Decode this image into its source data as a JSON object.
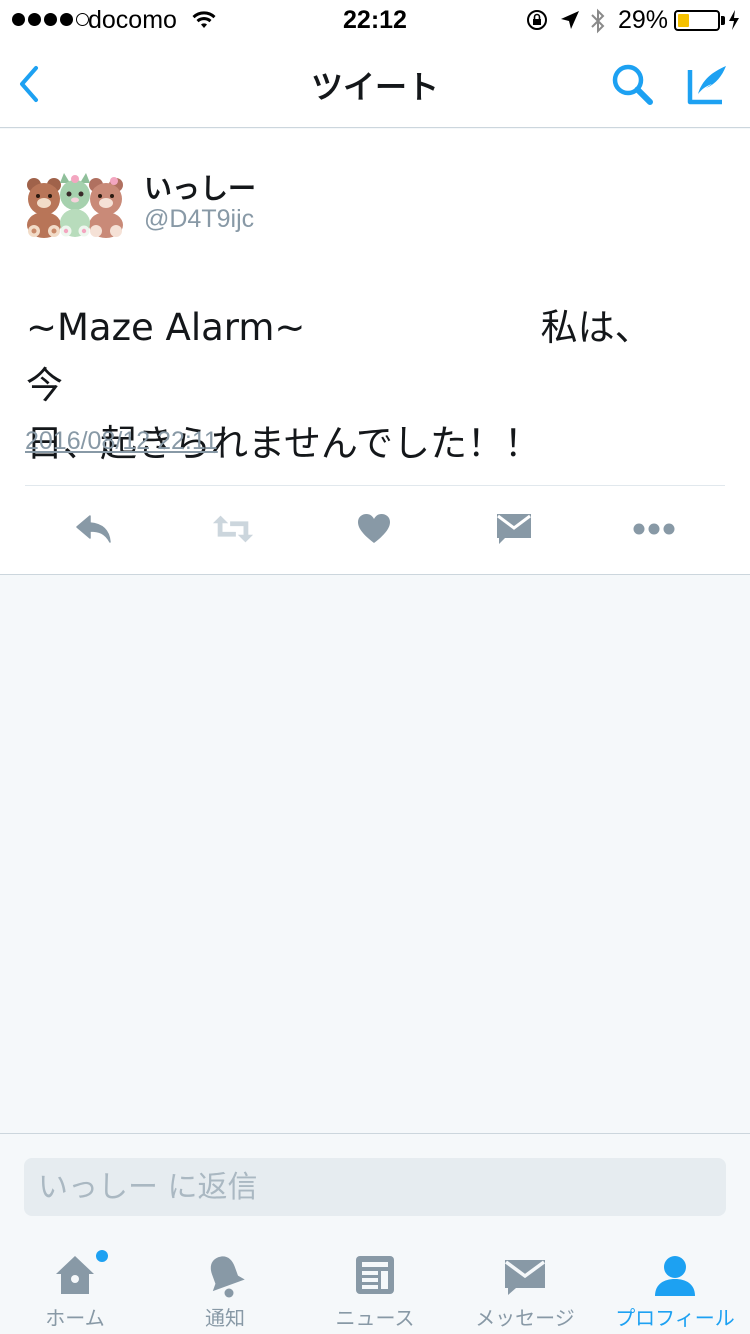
{
  "status_bar": {
    "carrier": "docomo",
    "time": "22:12",
    "battery_percent": "29%",
    "battery_level": 0.29
  },
  "nav": {
    "title": "ツイート"
  },
  "tweet": {
    "display_name": "いっしー",
    "handle": "@D4T9ijc",
    "text_line1": "~Maze Alarm~                    私は、今",
    "text_line2": "日、起きられませんでした！！",
    "timestamp": "2016/08/12 22:11"
  },
  "reply": {
    "placeholder": "いっしー に返信"
  },
  "tabs": [
    {
      "label": "ホーム",
      "icon": "home-icon"
    },
    {
      "label": "通知",
      "icon": "bell-icon"
    },
    {
      "label": "ニュース",
      "icon": "news-icon"
    },
    {
      "label": "メッセージ",
      "icon": "mail-icon"
    },
    {
      "label": "プロフィール",
      "icon": "profile-icon"
    }
  ],
  "colors": {
    "accent": "#1da1f2",
    "icon_gray": "#8899a6",
    "background": "#f5f8fa"
  }
}
